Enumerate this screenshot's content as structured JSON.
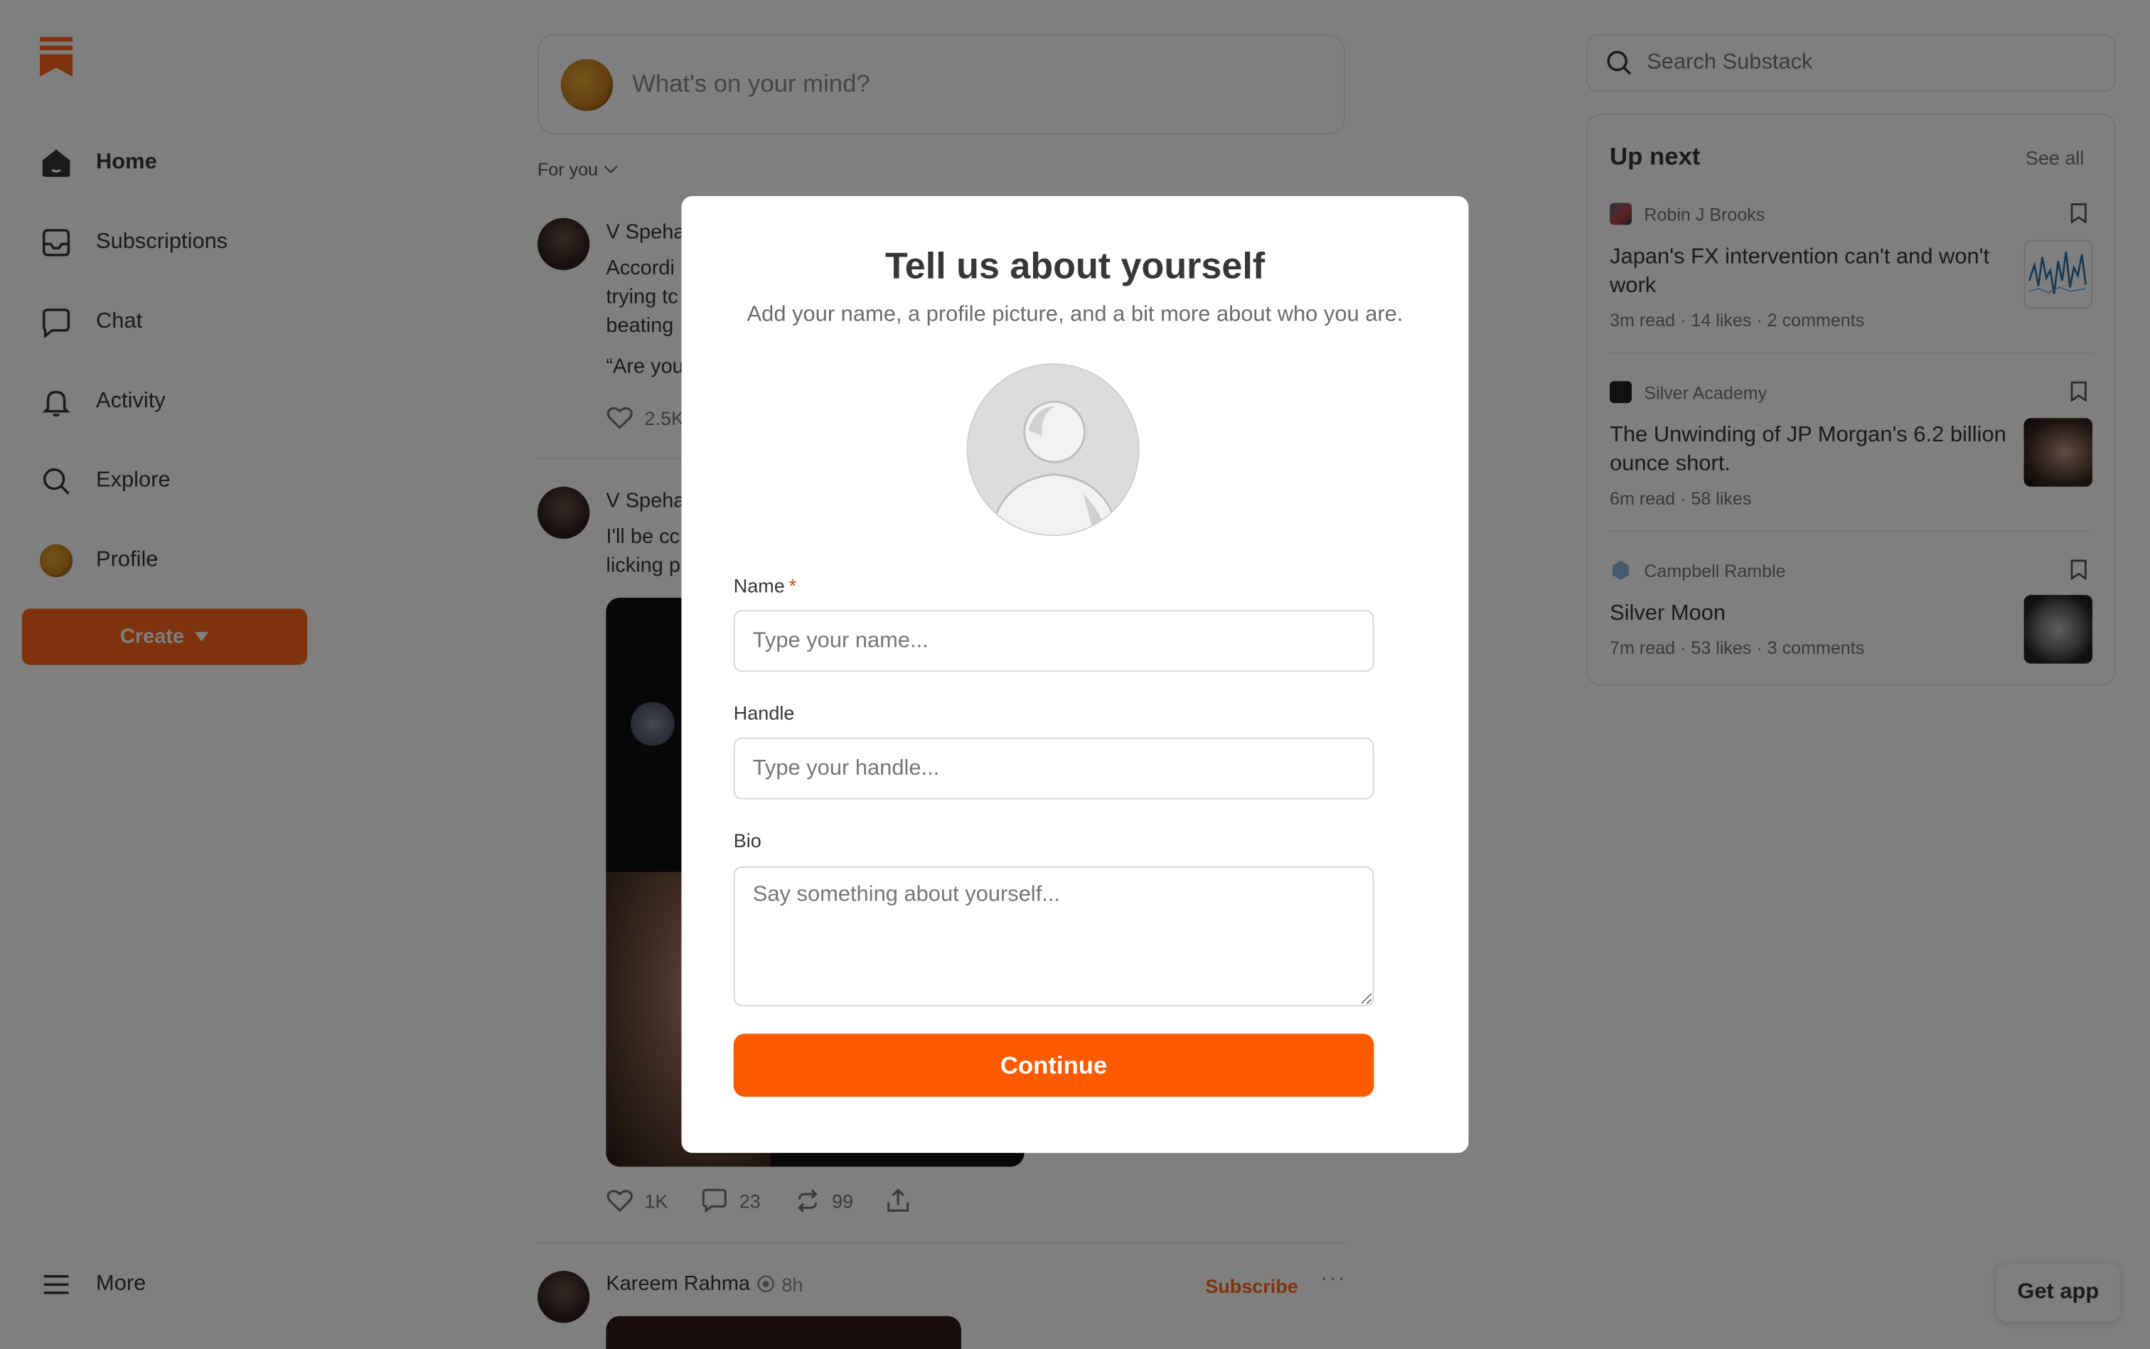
{
  "sidebar": {
    "items": [
      {
        "label": "Home",
        "icon": "home-icon"
      },
      {
        "label": "Subscriptions",
        "icon": "inbox-icon"
      },
      {
        "label": "Chat",
        "icon": "chat-icon"
      },
      {
        "label": "Activity",
        "icon": "bell-icon"
      },
      {
        "label": "Explore",
        "icon": "search-icon"
      },
      {
        "label": "Profile",
        "icon": "avatar"
      }
    ],
    "create_label": "Create",
    "more_label": "More"
  },
  "feed": {
    "composer_placeholder": "What's on your mind?",
    "tab_label": "For you",
    "post1": {
      "author": "V Speha",
      "lines": [
        "Accordi",
        "trying tc",
        "beating"
      ],
      "quote": "“Are you",
      "likes": "2.5K"
    },
    "post2": {
      "author": "V Speha",
      "lines": [
        "I'll be cc",
        "licking p"
      ],
      "likes": "1K",
      "comments": "23",
      "restacks": "99"
    },
    "post3": {
      "author": "Kareem Rahma",
      "time": "8h",
      "subscribe_label": "Subscribe",
      "more": "···"
    }
  },
  "right": {
    "search_placeholder": "Search Substack",
    "upnext": {
      "title": "Up next",
      "see_all": "See all",
      "items": [
        {
          "publication": "Robin J Brooks",
          "title": "Japan's FX intervention can't and won't work",
          "meta": "3m read · 14 likes · 2 comments"
        },
        {
          "publication": "Silver Academy",
          "title": "The Unwinding of JP Morgan's 6.2 billion ounce short.",
          "meta": "6m read · 58 likes"
        },
        {
          "publication": "Campbell Ramble",
          "title": "Silver Moon",
          "meta": "7m read · 53 likes · 3 comments"
        }
      ]
    },
    "get_app": "Get app"
  },
  "modal": {
    "title": "Tell us about yourself",
    "subtitle": "Add your name, a profile picture, and a bit more about who you are.",
    "name_label": "Name",
    "name_required": "*",
    "name_placeholder": "Type your name...",
    "handle_label": "Handle",
    "handle_placeholder": "Type your handle...",
    "bio_label": "Bio",
    "bio_placeholder": "Say something about yourself...",
    "continue_label": "Continue"
  },
  "colors": {
    "brand": "#FF6719",
    "continue": "#FF5A00",
    "overlay": "rgba(0,0,0,0.5)"
  }
}
